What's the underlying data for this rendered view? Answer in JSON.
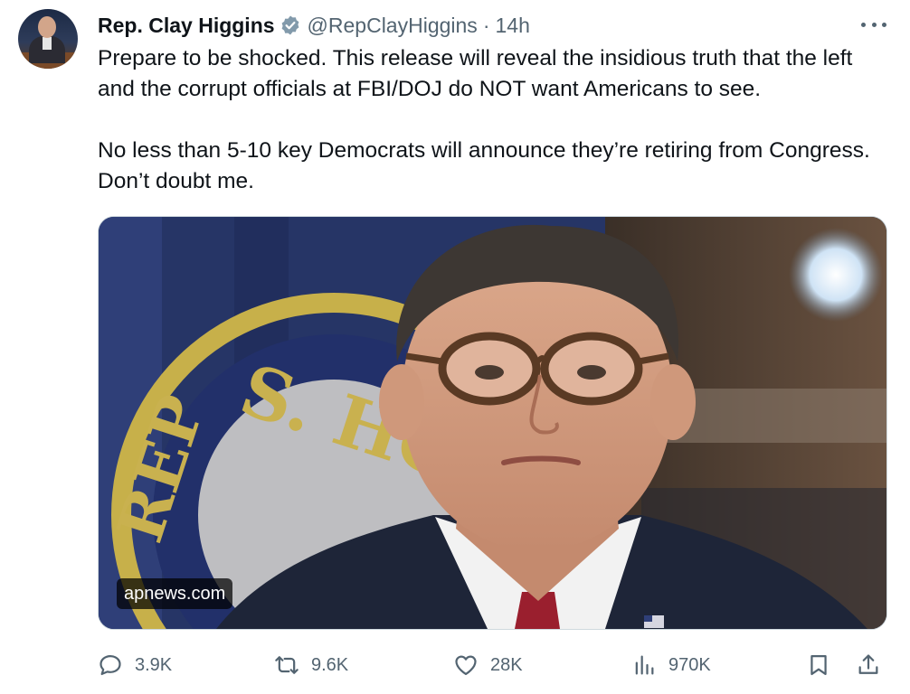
{
  "author": {
    "display_name": "Rep. Clay Higgins",
    "handle": "@RepClayHiggins",
    "separator": "·",
    "time_ago": "14h",
    "verified": true
  },
  "tweet": {
    "paragraphs": [
      "Prepare to be shocked. This release will reveal the insidious truth that the left and the corrupt officials at FBI/DOJ do NOT want Americans to see.",
      "No less than 5-10 key Democrats will announce they’re retiring from Congress. Don’t doubt me."
    ]
  },
  "media": {
    "source_label": "apnews.com",
    "seal_text": "S. HO",
    "seal_text_2": "REP"
  },
  "metrics": {
    "replies": "3.9K",
    "reposts": "9.6K",
    "likes": "28K",
    "views": "970K"
  },
  "colors": {
    "text": "#0f1419",
    "secondary": "#536471",
    "verified_badge": "#829aab",
    "border": "#cfd9de"
  },
  "icons": {
    "reply": "speech-bubble-icon",
    "repost": "repost-arrows-icon",
    "like": "heart-icon",
    "views": "bar-chart-icon",
    "bookmark": "bookmark-icon",
    "share": "share-upload-icon",
    "more": "more-dots-icon",
    "verified": "verified-badge-icon"
  }
}
